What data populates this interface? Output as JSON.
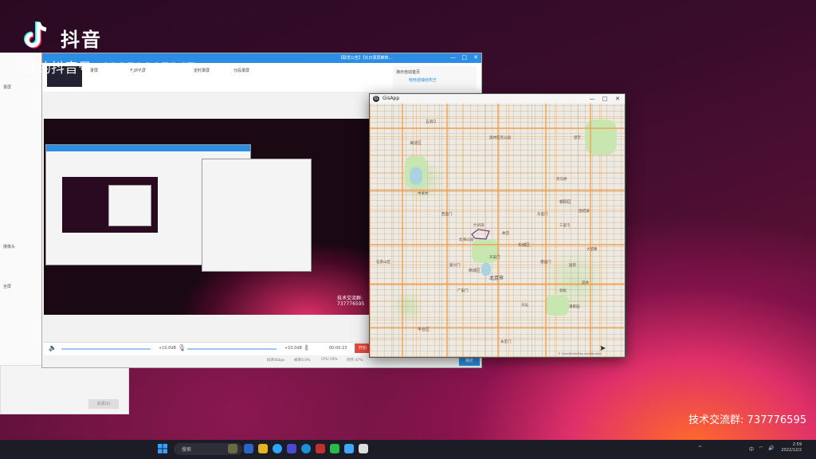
{
  "overlay": {
    "logo_text": "抖音",
    "douyin_id": "我的抖音号: 42159207347",
    "tech_group": "技术交流群: 737776595"
  },
  "recorder": {
    "title_text": "【联觉公告】【长日录屏推荐…",
    "tabs": [
      "录屏",
      "自动录屏",
      "定时录屏",
      "分段录屏"
    ],
    "side_text": "演示自动首页",
    "side_sub": "哈哈道输结构王",
    "left_labels": [
      "录屏",
      "摄像头",
      "全屏"
    ],
    "vol_left": "+10.0dB",
    "vol_right": "+10.0dB",
    "timer": "00:00:23",
    "start_label": "开始",
    "status": [
      "码率0kbps",
      "帧率0.0%",
      "CPU:10%",
      "内存:47%"
    ],
    "confirm_label": "确定",
    "preview_overlay": "技术交流群: 737776595",
    "lower_btn": "关闭(2)"
  },
  "gis": {
    "title": "GisApp",
    "controls": [
      "—",
      "□",
      "✕"
    ],
    "map_labels": [
      "北京市",
      "西城区",
      "东城区",
      "朝阳区",
      "海淀区",
      "丰台区",
      "石景山区",
      "天安门",
      "什刹海",
      "北海公园",
      "故宫",
      "天坛",
      "国贸",
      "三里屯",
      "望京",
      "中关村",
      "五道口",
      "西直门",
      "东直门",
      "建国门",
      "复兴门",
      "广安门",
      "永定门",
      "潘家园",
      "劲松",
      "双井",
      "大望路",
      "团结湖",
      "亮马桥",
      "奥林匹克公园"
    ],
    "attribution": "© OpenStreetMap contributors"
  },
  "taskbar": {
    "search_placeholder": "搜索",
    "clock_time": "2:59",
    "clock_date": "2022/12/2",
    "ime": "中",
    "colors": {
      "bar": "#1c1c26",
      "accent": "#2b8ee4"
    }
  }
}
